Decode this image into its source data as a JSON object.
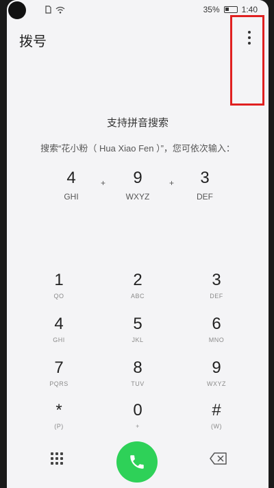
{
  "status_bar": {
    "battery": "35%",
    "time": "1:40"
  },
  "header": {
    "title": "拨号"
  },
  "hint": {
    "title": "支持拼音搜索",
    "example": "搜索“花小粉（ Hua Xiao Fen ）”，您可依次输入："
  },
  "pinyin_example": [
    {
      "digit": "4",
      "letters": "GHI"
    },
    {
      "digit": "9",
      "letters": "WXYZ"
    },
    {
      "digit": "3",
      "letters": "DEF"
    }
  ],
  "plus_sign": "+",
  "keypad": [
    {
      "digit": "1",
      "letters": "QO"
    },
    {
      "digit": "2",
      "letters": "ABC"
    },
    {
      "digit": "3",
      "letters": "DEF"
    },
    {
      "digit": "4",
      "letters": "GHI"
    },
    {
      "digit": "5",
      "letters": "JKL"
    },
    {
      "digit": "6",
      "letters": "MNO"
    },
    {
      "digit": "7",
      "letters": "PQRS"
    },
    {
      "digit": "8",
      "letters": "TUV"
    },
    {
      "digit": "9",
      "letters": "WXYZ"
    },
    {
      "digit": "*",
      "letters": "(P)"
    },
    {
      "digit": "0",
      "letters": "+"
    },
    {
      "digit": "#",
      "letters": "(W)"
    }
  ],
  "colors": {
    "call_green": "#2ed158",
    "highlight_red": "#e02020",
    "background": "#f4f4f6"
  },
  "icons": {
    "menu": "more-vertical-icon",
    "dialpad": "dialpad-grid-icon",
    "call": "phone-icon",
    "backspace": "backspace-icon"
  }
}
